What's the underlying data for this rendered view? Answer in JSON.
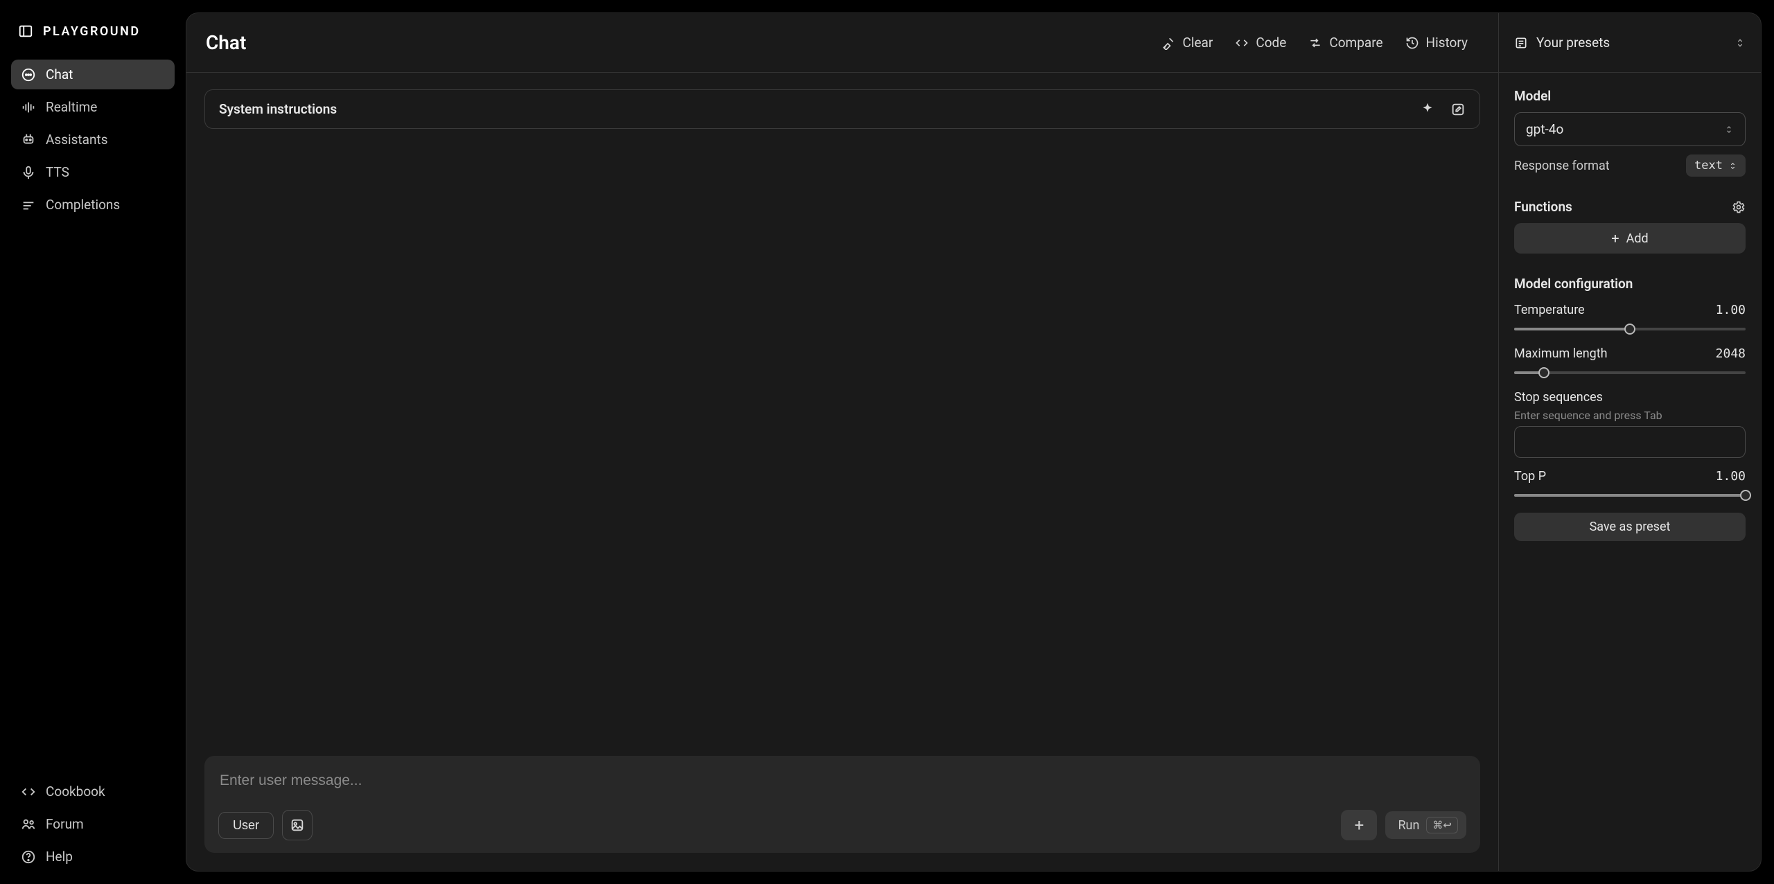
{
  "brand": "PLAYGROUND",
  "nav": {
    "top": [
      {
        "label": "Chat"
      },
      {
        "label": "Realtime"
      },
      {
        "label": "Assistants"
      },
      {
        "label": "TTS"
      },
      {
        "label": "Completions"
      }
    ],
    "bottom": [
      {
        "label": "Cookbook"
      },
      {
        "label": "Forum"
      },
      {
        "label": "Help"
      }
    ]
  },
  "header": {
    "title": "Chat",
    "clear": "Clear",
    "code": "Code",
    "compare": "Compare",
    "history": "History"
  },
  "system": {
    "label": "System instructions"
  },
  "composer": {
    "placeholder": "Enter user message...",
    "role": "User",
    "run": "Run",
    "shortcut": "⌘↩"
  },
  "presets": {
    "label": "Your presets"
  },
  "model": {
    "label": "Model",
    "selected": "gpt-4o",
    "response_format_label": "Response format",
    "response_format_value": "text"
  },
  "functions": {
    "label": "Functions",
    "add": "Add"
  },
  "config": {
    "label": "Model configuration",
    "temperature_label": "Temperature",
    "temperature_value": "1.00",
    "temperature_pct": 50,
    "maxlen_label": "Maximum length",
    "maxlen_value": "2048",
    "maxlen_pct": 13,
    "stop_label": "Stop sequences",
    "stop_hint": "Enter sequence and press Tab",
    "topp_label": "Top P",
    "topp_value": "1.00",
    "topp_pct": 100,
    "save_preset": "Save as preset"
  }
}
